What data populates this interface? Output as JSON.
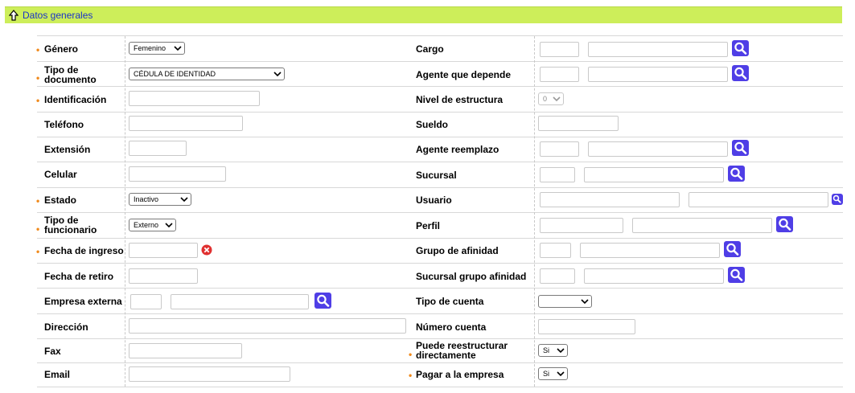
{
  "section": {
    "title": "Datos generales",
    "icon": "arrow-up-icon"
  },
  "required_marker": "•",
  "left": {
    "genero": {
      "label": "Género",
      "value": "Femenino"
    },
    "tipo_documento": {
      "label": "Tipo de documento",
      "value": "CÉDULA DE IDENTIDAD"
    },
    "identificacion": {
      "label": "Identificación"
    },
    "telefono": {
      "label": "Teléfono"
    },
    "extension": {
      "label": "Extensión"
    },
    "celular": {
      "label": "Celular"
    },
    "estado": {
      "label": "Estado",
      "value": "Inactivo"
    },
    "tipo_funcionario": {
      "label": "Tipo de funcionario",
      "value": "Externo"
    },
    "fecha_ingreso": {
      "label": "Fecha de ingreso"
    },
    "fecha_retiro": {
      "label": "Fecha de retiro"
    },
    "empresa_externa": {
      "label": "Empresa externa"
    },
    "direccion": {
      "label": "Dirección"
    },
    "fax": {
      "label": "Fax"
    },
    "email": {
      "label": "Email"
    }
  },
  "right": {
    "cargo": {
      "label": "Cargo"
    },
    "agente_depende": {
      "label": "Agente que depende"
    },
    "nivel_estructura": {
      "label": "Nivel de estructura",
      "value": "0"
    },
    "sueldo": {
      "label": "Sueldo"
    },
    "agente_reemplazo": {
      "label": "Agente reemplazo"
    },
    "sucursal": {
      "label": "Sucursal"
    },
    "usuario": {
      "label": "Usuario"
    },
    "perfil": {
      "label": "Perfil"
    },
    "grupo_afinidad": {
      "label": "Grupo de afinidad"
    },
    "sucursal_grupo_afinidad": {
      "label": "Sucursal grupo afinidad"
    },
    "tipo_cuenta": {
      "label": "Tipo de cuenta",
      "value": ""
    },
    "numero_cuenta": {
      "label": "Número cuenta"
    },
    "puede_reestructurar": {
      "label": "Puede reestructurar directamente",
      "value": "Si"
    },
    "pagar_empresa": {
      "label": "Pagar a la empresa",
      "value": "Si"
    }
  },
  "colors": {
    "header_bg": "#cdee5a",
    "header_text": "#1a33c8",
    "search_button": "#4f3ee6",
    "required": "#f08a1c",
    "clear": "#e03030"
  }
}
